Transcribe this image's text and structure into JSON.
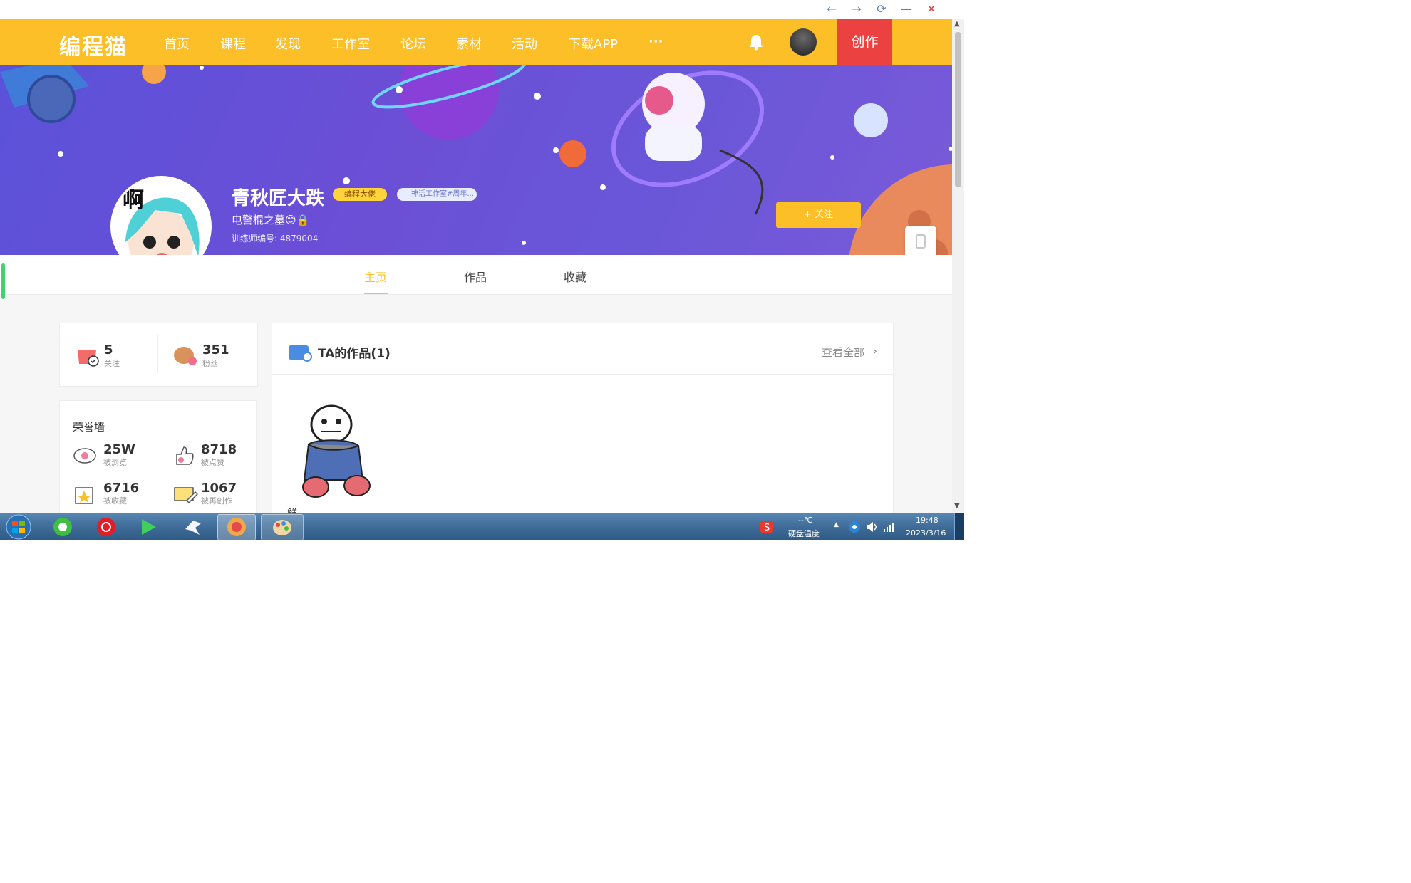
{
  "window": {
    "controls": [
      "←",
      "→",
      "⟳",
      "—",
      "✕"
    ]
  },
  "nav": {
    "logo": "编程猫",
    "items": [
      "首页",
      "课程",
      "发现",
      "工作室",
      "论坛",
      "素材",
      "活动",
      "下载APP",
      "···"
    ],
    "create": "创作"
  },
  "profile": {
    "avatar_text": "啊",
    "username": "青秋匠大跌",
    "badge": "编程大佬",
    "studio_badge": "神话工作室#周年...",
    "signature": "电警棍之墓😊🔒",
    "trainer_id": "训练师编号: 4879004",
    "follow_label": "+ 关注"
  },
  "tabs": [
    "主页",
    "作品",
    "收藏"
  ],
  "stats": {
    "following": {
      "value": "5",
      "label": "关注"
    },
    "fans": {
      "value": "351",
      "label": "粉丝"
    }
  },
  "honor": {
    "title": "荣誉墙",
    "items": [
      {
        "value": "25W",
        "label": "被浏览",
        "icon": "eye-icon"
      },
      {
        "value": "8718",
        "label": "被点赞",
        "icon": "thumb-icon"
      },
      {
        "value": "6716",
        "label": "被收藏",
        "icon": "star-box-icon"
      },
      {
        "value": "1067",
        "label": "被再创作",
        "icon": "pencil-icon"
      }
    ]
  },
  "works": {
    "title": "TA的作品(1)",
    "see_all": "查看全部",
    "items": [
      {
        "name": "鲜"
      }
    ]
  },
  "taskbar": {
    "temp": "--℃",
    "disk_label": "硬盘温度",
    "time": "19:48",
    "date": "2023/3/16"
  }
}
